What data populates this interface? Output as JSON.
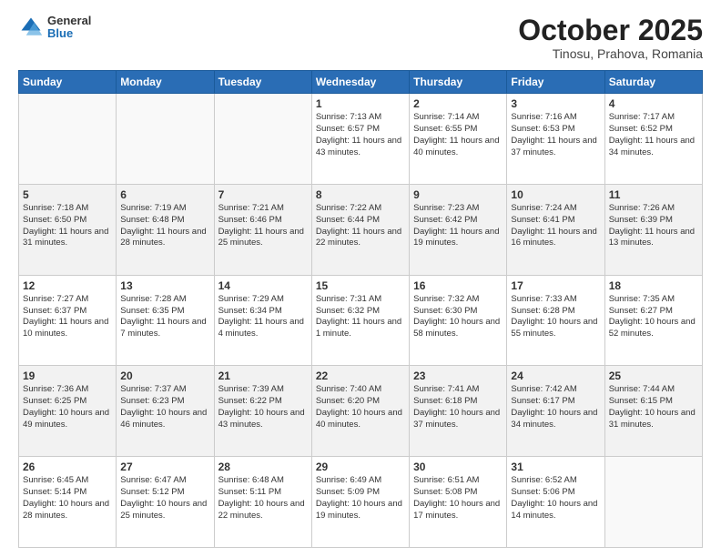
{
  "header": {
    "logo": {
      "line1": "General",
      "line2": "Blue"
    },
    "title": "October 2025",
    "location": "Tinosu, Prahova, Romania"
  },
  "weekdays": [
    "Sunday",
    "Monday",
    "Tuesday",
    "Wednesday",
    "Thursday",
    "Friday",
    "Saturday"
  ],
  "weeks": [
    [
      {
        "day": "",
        "sunrise": "",
        "sunset": "",
        "daylight": ""
      },
      {
        "day": "",
        "sunrise": "",
        "sunset": "",
        "daylight": ""
      },
      {
        "day": "",
        "sunrise": "",
        "sunset": "",
        "daylight": ""
      },
      {
        "day": "1",
        "sunrise": "Sunrise: 7:13 AM",
        "sunset": "Sunset: 6:57 PM",
        "daylight": "Daylight: 11 hours and 43 minutes."
      },
      {
        "day": "2",
        "sunrise": "Sunrise: 7:14 AM",
        "sunset": "Sunset: 6:55 PM",
        "daylight": "Daylight: 11 hours and 40 minutes."
      },
      {
        "day": "3",
        "sunrise": "Sunrise: 7:16 AM",
        "sunset": "Sunset: 6:53 PM",
        "daylight": "Daylight: 11 hours and 37 minutes."
      },
      {
        "day": "4",
        "sunrise": "Sunrise: 7:17 AM",
        "sunset": "Sunset: 6:52 PM",
        "daylight": "Daylight: 11 hours and 34 minutes."
      }
    ],
    [
      {
        "day": "5",
        "sunrise": "Sunrise: 7:18 AM",
        "sunset": "Sunset: 6:50 PM",
        "daylight": "Daylight: 11 hours and 31 minutes."
      },
      {
        "day": "6",
        "sunrise": "Sunrise: 7:19 AM",
        "sunset": "Sunset: 6:48 PM",
        "daylight": "Daylight: 11 hours and 28 minutes."
      },
      {
        "day": "7",
        "sunrise": "Sunrise: 7:21 AM",
        "sunset": "Sunset: 6:46 PM",
        "daylight": "Daylight: 11 hours and 25 minutes."
      },
      {
        "day": "8",
        "sunrise": "Sunrise: 7:22 AM",
        "sunset": "Sunset: 6:44 PM",
        "daylight": "Daylight: 11 hours and 22 minutes."
      },
      {
        "day": "9",
        "sunrise": "Sunrise: 7:23 AM",
        "sunset": "Sunset: 6:42 PM",
        "daylight": "Daylight: 11 hours and 19 minutes."
      },
      {
        "day": "10",
        "sunrise": "Sunrise: 7:24 AM",
        "sunset": "Sunset: 6:41 PM",
        "daylight": "Daylight: 11 hours and 16 minutes."
      },
      {
        "day": "11",
        "sunrise": "Sunrise: 7:26 AM",
        "sunset": "Sunset: 6:39 PM",
        "daylight": "Daylight: 11 hours and 13 minutes."
      }
    ],
    [
      {
        "day": "12",
        "sunrise": "Sunrise: 7:27 AM",
        "sunset": "Sunset: 6:37 PM",
        "daylight": "Daylight: 11 hours and 10 minutes."
      },
      {
        "day": "13",
        "sunrise": "Sunrise: 7:28 AM",
        "sunset": "Sunset: 6:35 PM",
        "daylight": "Daylight: 11 hours and 7 minutes."
      },
      {
        "day": "14",
        "sunrise": "Sunrise: 7:29 AM",
        "sunset": "Sunset: 6:34 PM",
        "daylight": "Daylight: 11 hours and 4 minutes."
      },
      {
        "day": "15",
        "sunrise": "Sunrise: 7:31 AM",
        "sunset": "Sunset: 6:32 PM",
        "daylight": "Daylight: 11 hours and 1 minute."
      },
      {
        "day": "16",
        "sunrise": "Sunrise: 7:32 AM",
        "sunset": "Sunset: 6:30 PM",
        "daylight": "Daylight: 10 hours and 58 minutes."
      },
      {
        "day": "17",
        "sunrise": "Sunrise: 7:33 AM",
        "sunset": "Sunset: 6:28 PM",
        "daylight": "Daylight: 10 hours and 55 minutes."
      },
      {
        "day": "18",
        "sunrise": "Sunrise: 7:35 AM",
        "sunset": "Sunset: 6:27 PM",
        "daylight": "Daylight: 10 hours and 52 minutes."
      }
    ],
    [
      {
        "day": "19",
        "sunrise": "Sunrise: 7:36 AM",
        "sunset": "Sunset: 6:25 PM",
        "daylight": "Daylight: 10 hours and 49 minutes."
      },
      {
        "day": "20",
        "sunrise": "Sunrise: 7:37 AM",
        "sunset": "Sunset: 6:23 PM",
        "daylight": "Daylight: 10 hours and 46 minutes."
      },
      {
        "day": "21",
        "sunrise": "Sunrise: 7:39 AM",
        "sunset": "Sunset: 6:22 PM",
        "daylight": "Daylight: 10 hours and 43 minutes."
      },
      {
        "day": "22",
        "sunrise": "Sunrise: 7:40 AM",
        "sunset": "Sunset: 6:20 PM",
        "daylight": "Daylight: 10 hours and 40 minutes."
      },
      {
        "day": "23",
        "sunrise": "Sunrise: 7:41 AM",
        "sunset": "Sunset: 6:18 PM",
        "daylight": "Daylight: 10 hours and 37 minutes."
      },
      {
        "day": "24",
        "sunrise": "Sunrise: 7:42 AM",
        "sunset": "Sunset: 6:17 PM",
        "daylight": "Daylight: 10 hours and 34 minutes."
      },
      {
        "day": "25",
        "sunrise": "Sunrise: 7:44 AM",
        "sunset": "Sunset: 6:15 PM",
        "daylight": "Daylight: 10 hours and 31 minutes."
      }
    ],
    [
      {
        "day": "26",
        "sunrise": "Sunrise: 6:45 AM",
        "sunset": "Sunset: 5:14 PM",
        "daylight": "Daylight: 10 hours and 28 minutes."
      },
      {
        "day": "27",
        "sunrise": "Sunrise: 6:47 AM",
        "sunset": "Sunset: 5:12 PM",
        "daylight": "Daylight: 10 hours and 25 minutes."
      },
      {
        "day": "28",
        "sunrise": "Sunrise: 6:48 AM",
        "sunset": "Sunset: 5:11 PM",
        "daylight": "Daylight: 10 hours and 22 minutes."
      },
      {
        "day": "29",
        "sunrise": "Sunrise: 6:49 AM",
        "sunset": "Sunset: 5:09 PM",
        "daylight": "Daylight: 10 hours and 19 minutes."
      },
      {
        "day": "30",
        "sunrise": "Sunrise: 6:51 AM",
        "sunset": "Sunset: 5:08 PM",
        "daylight": "Daylight: 10 hours and 17 minutes."
      },
      {
        "day": "31",
        "sunrise": "Sunrise: 6:52 AM",
        "sunset": "Sunset: 5:06 PM",
        "daylight": "Daylight: 10 hours and 14 minutes."
      },
      {
        "day": "",
        "sunrise": "",
        "sunset": "",
        "daylight": ""
      }
    ]
  ]
}
